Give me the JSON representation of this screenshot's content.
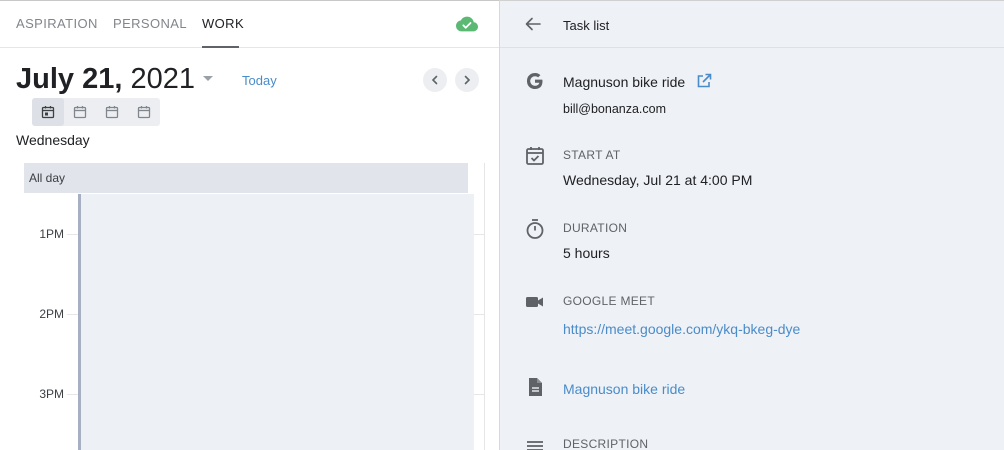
{
  "tabs": [
    {
      "label": "ASPIRATION"
    },
    {
      "label": "PERSONAL"
    },
    {
      "label": "WORK"
    }
  ],
  "active_tab": "WORK",
  "sync_status_icon": "cloud-check-icon",
  "calendar": {
    "date_month_day": "July 21,",
    "date_year": "2021",
    "today_label": "Today",
    "weekday": "Wednesday",
    "allday_label": "All day",
    "hours": [
      "1PM",
      "2PM",
      "3PM"
    ],
    "view_icons": [
      "day-view-icon",
      "three-day-view-icon",
      "week-view-icon",
      "month-view-icon"
    ]
  },
  "detail": {
    "header_title": "Task list",
    "event_title": "Magnuson bike ride",
    "email": "bill@bonanza.com",
    "start_label": "START AT",
    "start_value": "Wednesday, Jul 21 at 4:00 PM",
    "duration_label": "DURATION",
    "duration_value": "5 hours",
    "meet_label": "GOOGLE MEET",
    "meet_link": "https://meet.google.com/ykq-bkeg-dye",
    "doc_link": "Magnuson bike ride",
    "description_label": "DESCRIPTION"
  },
  "colors": {
    "accent_link": "#4a8cc9",
    "cloud_green": "#5bb974",
    "panel_bg": "#eef1f6"
  }
}
